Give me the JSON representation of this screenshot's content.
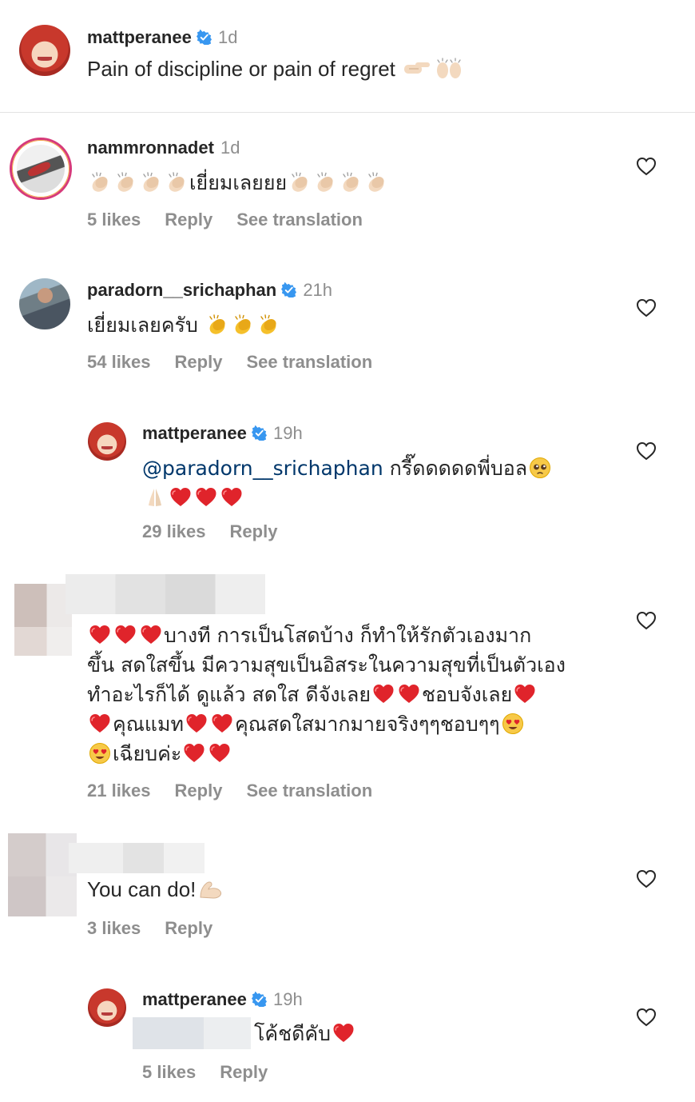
{
  "caption": {
    "username": "mattperanee",
    "time": "1d",
    "text": "Pain of discipline or pain of regret"
  },
  "comments": [
    {
      "username": "nammronnadet",
      "time": "1d",
      "text": "เยี่ยมเลยยย",
      "likes": "5 likes",
      "reply": "Reply",
      "translate": "See translation"
    },
    {
      "username": "paradorn__srichaphan",
      "time": "21h",
      "text": "เยี่ยมเลยครับ",
      "likes": "54 likes",
      "reply": "Reply",
      "translate": "See translation"
    },
    {
      "username": "mattperanee",
      "time": "19h",
      "mention": "@paradorn__srichaphan",
      "text": "กรี๊ดดดดดพี่บอล",
      "likes": "29 likes",
      "reply": "Reply"
    },
    {
      "text_line1": "บางที การเป็นโสดบ้าง  ก็ทำให้รักตัวเองมาก",
      "text_line2": "ขึ้น สดใสขึ้น มีความสุขเป็นอิสระในความสุขที่เป็นตัวเอง",
      "text_line3a": "ทำอะไรก็ได้ ดูแล้ว สดใส ดีจังเลย",
      "text_line3b": "ชอบจังเลย",
      "text_line4a": "คุณแมท",
      "text_line4b": "คุณสดใสมากมายจริงๆๆชอบๆๆ",
      "text_line5": "เฉียบค่ะ",
      "likes": "21 likes",
      "reply": "Reply",
      "translate": "See translation"
    },
    {
      "text": "You can do!",
      "likes": "3 likes",
      "reply": "Reply"
    },
    {
      "username": "mattperanee",
      "time": "19h",
      "text": "โค้ชดีคับ",
      "likes": "5 likes",
      "reply": "Reply"
    }
  ],
  "colors": {
    "text": "#262626",
    "secondary": "#8e8e8e",
    "mention": "#00376b",
    "verified": "#3897f0",
    "heart_red": "#e0242b"
  }
}
